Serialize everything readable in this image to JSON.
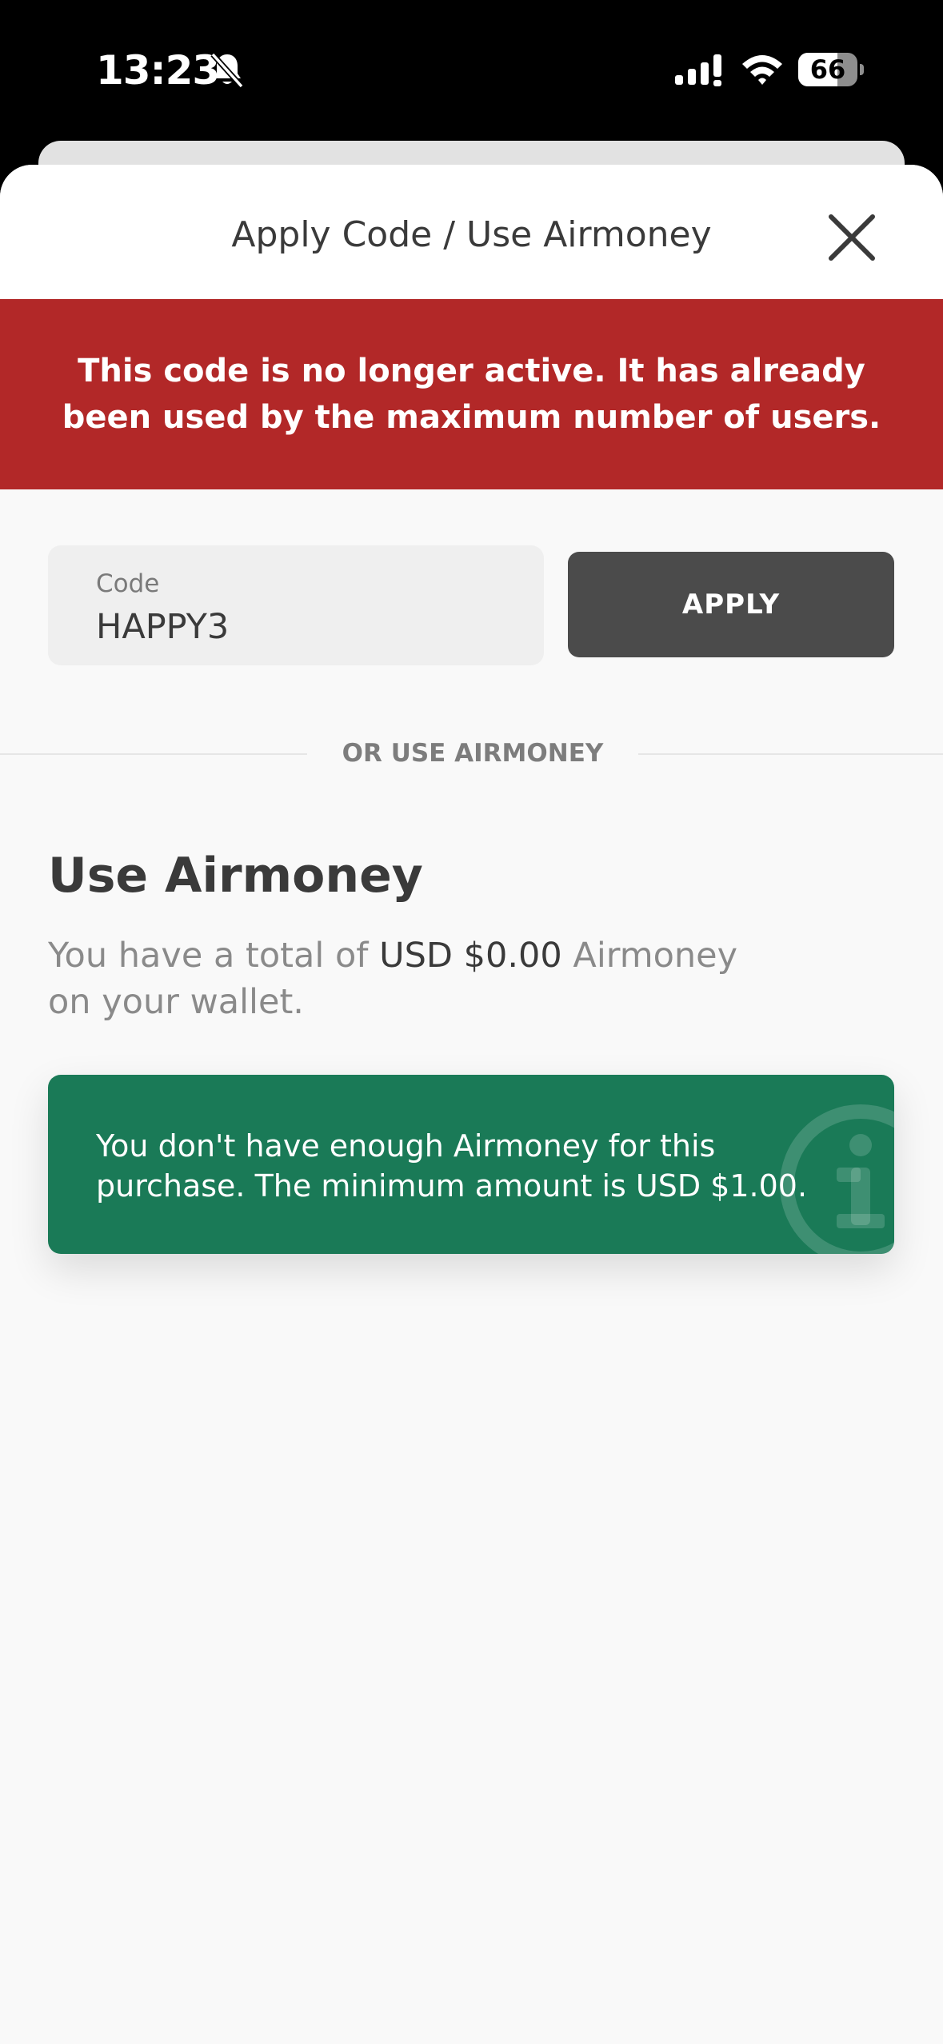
{
  "status_bar": {
    "time": "13:23",
    "battery_level": "66",
    "battery_fraction": 0.66
  },
  "sheet": {
    "title": "Apply Code / Use Airmoney",
    "error_message": "This code is no longer active. It has already been used by the maximum number of users."
  },
  "code_form": {
    "label": "Code",
    "value": "HAPPY3",
    "apply_label": "APPLY"
  },
  "divider": {
    "label": "OR USE AIRMONEY"
  },
  "airmoney": {
    "heading": "Use Airmoney",
    "desc_prefix": "You have a total of ",
    "amount": "USD $0.00",
    "desc_suffix": " Airmoney on your wallet.",
    "info_message": "You don't have enough Airmoney for this purchase. The minimum amount is USD $1.00."
  },
  "colors": {
    "error_banner": "#b22828",
    "info_card": "#1a7a57",
    "apply_button": "#4b4b4b"
  },
  "icons": {
    "close": "close-icon",
    "info": "info-icon",
    "bell": "bell-slash-icon",
    "signal": "cellular-signal-icon",
    "wifi": "wifi-icon"
  }
}
